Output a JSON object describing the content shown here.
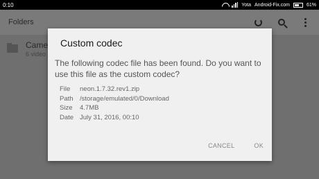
{
  "status_bar": {
    "time": "0:10",
    "carrier": "Yota",
    "site": "Android-Fix.com",
    "battery": "61%"
  },
  "app_bar": {
    "title": "Folders"
  },
  "list": {
    "item_name": "Came",
    "item_sub": "6 video"
  },
  "dialog": {
    "title": "Custom codec",
    "message": "The following codec file has been found. Do you want to use this file as the custom codec?",
    "details": [
      {
        "key": "File",
        "value": "neon.1.7.32.rev1.zip"
      },
      {
        "key": "Path",
        "value": "/storage/emulated/0/Download"
      },
      {
        "key": "Size",
        "value": "4.7MB"
      },
      {
        "key": "Date",
        "value": "July 31, 2016, 00:10"
      }
    ],
    "cancel_label": "CANCEL",
    "ok_label": "OK"
  }
}
